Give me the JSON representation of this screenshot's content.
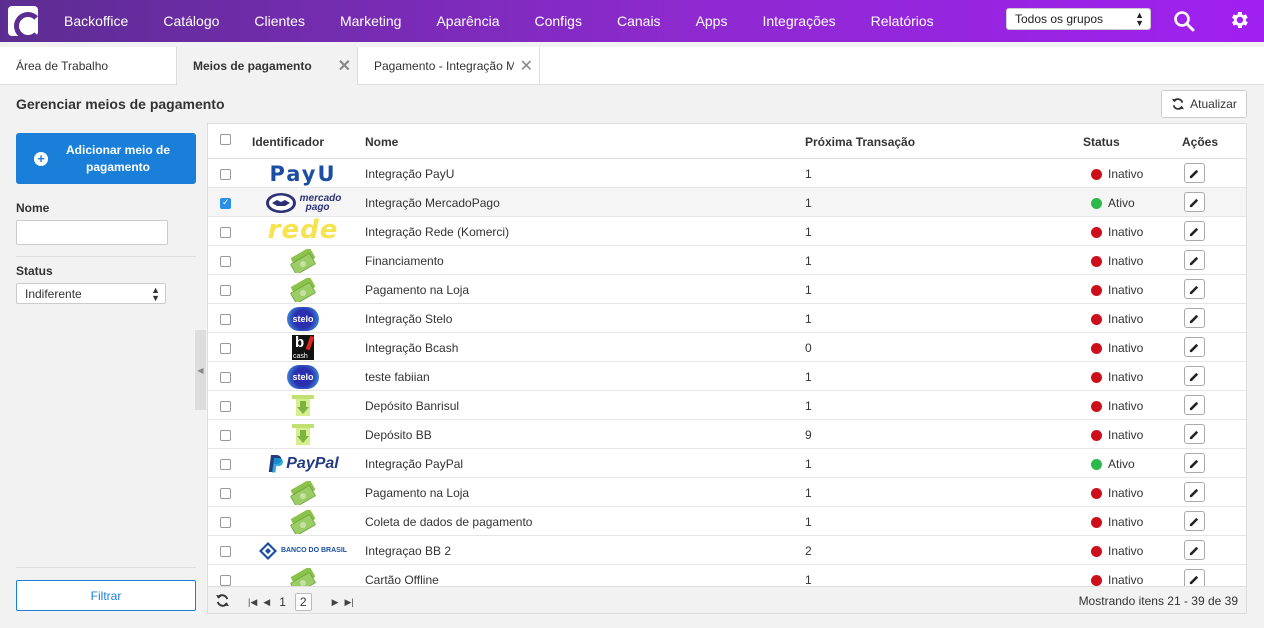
{
  "nav": {
    "items": [
      "Backoffice",
      "Catálogo",
      "Clientes",
      "Marketing",
      "Aparência",
      "Configs",
      "Canais",
      "Apps",
      "Integrações",
      "Relatórios"
    ],
    "group_select": "Todos os grupos"
  },
  "tabs": [
    {
      "label": "Área de Trabalho"
    },
    {
      "label": "Meios de pagamento"
    },
    {
      "label": "Pagamento - Integração M"
    }
  ],
  "page": {
    "title": "Gerenciar meios de pagamento",
    "refresh_label": "Atualizar"
  },
  "sidebar": {
    "add_label": "Adicionar meio de pagamento",
    "name_label": "Nome",
    "name_value": "",
    "status_label": "Status",
    "status_value": "Indiferente",
    "filter_label": "Filtrar"
  },
  "grid": {
    "headers": {
      "id": "Identificador",
      "name": "Nome",
      "next": "Próxima Transação",
      "status": "Status",
      "actions": "Ações"
    },
    "colors": {
      "inactive": "#cc0f1a",
      "active": "#2db84b"
    },
    "rows": [
      {
        "logo": "payu",
        "name": "Integração PayU",
        "next": "1",
        "status": "Inativo",
        "checked": false
      },
      {
        "logo": "mercadopago",
        "name": "Integração MercadoPago",
        "next": "1",
        "status": "Ativo",
        "checked": true
      },
      {
        "logo": "rede",
        "name": "Integração Rede (Komerci)",
        "next": "1",
        "status": "Inativo",
        "checked": false
      },
      {
        "logo": "money",
        "name": "Financiamento",
        "next": "1",
        "status": "Inativo",
        "checked": false
      },
      {
        "logo": "money",
        "name": "Pagamento na Loja",
        "next": "1",
        "status": "Inativo",
        "checked": false
      },
      {
        "logo": "stelo",
        "name": "Integração Stelo",
        "next": "1",
        "status": "Inativo",
        "checked": false
      },
      {
        "logo": "bcash",
        "name": "Integração Bcash",
        "next": "0",
        "status": "Inativo",
        "checked": false
      },
      {
        "logo": "stelo",
        "name": "teste fabiian",
        "next": "1",
        "status": "Inativo",
        "checked": false
      },
      {
        "logo": "deposit",
        "name": "Depósito Banrisul",
        "next": "1",
        "status": "Inativo",
        "checked": false
      },
      {
        "logo": "deposit",
        "name": "Depósito BB",
        "next": "9",
        "status": "Inativo",
        "checked": false
      },
      {
        "logo": "paypal",
        "name": "Integração PayPal",
        "next": "1",
        "status": "Ativo",
        "checked": false
      },
      {
        "logo": "money",
        "name": "Pagamento na Loja",
        "next": "1",
        "status": "Inativo",
        "checked": false
      },
      {
        "logo": "money",
        "name": "Coleta de dados de pagamento",
        "next": "1",
        "status": "Inativo",
        "checked": false
      },
      {
        "logo": "bb",
        "name": "Integraçao BB 2",
        "next": "2",
        "status": "Inativo",
        "checked": false
      },
      {
        "logo": "money",
        "name": "Cartão Offline",
        "next": "1",
        "status": "Inativo",
        "checked": false
      }
    ],
    "logo_text": {
      "payu": "PayU",
      "mercadopago_1": "mercado",
      "mercadopago_2": "pago",
      "rede": "rede",
      "stelo": "stelo",
      "bcash_1": "b",
      "bcash_2": "cash",
      "paypal": "PayPal",
      "bb": "BANCO DO BRASIL"
    },
    "pager": {
      "pages": [
        "1",
        "2"
      ],
      "current": "2",
      "info": "Mostrando itens 21 - 39 de 39"
    }
  }
}
